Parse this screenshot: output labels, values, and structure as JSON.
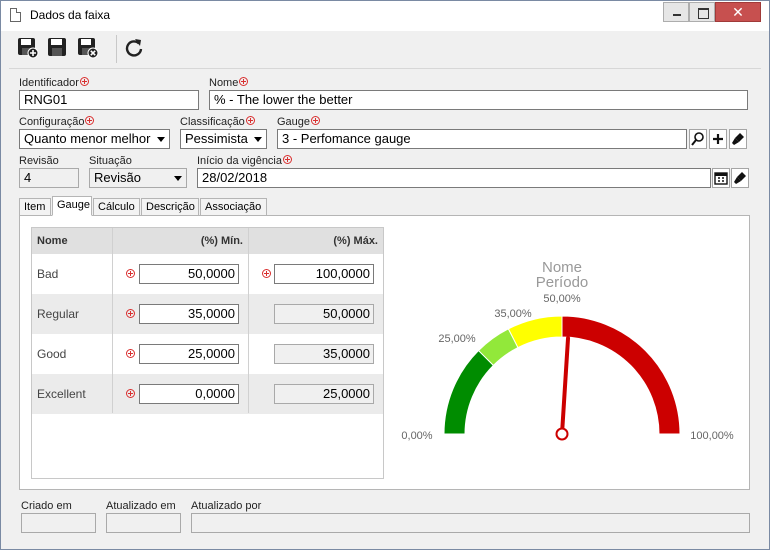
{
  "window": {
    "title": "Dados da faixa"
  },
  "toolbar": {
    "buttons": [
      "save-new-icon",
      "save-icon",
      "save-close-icon",
      "refresh-icon"
    ]
  },
  "form": {
    "identificador": {
      "label": "Identificador",
      "value": "RNG01"
    },
    "nome": {
      "label": "Nome",
      "value": "% - The lower the better"
    },
    "configuracao": {
      "label": "Configuração",
      "value": "Quanto menor melhor"
    },
    "classificacao": {
      "label": "Classificação",
      "value": "Pessimista"
    },
    "gauge": {
      "label": "Gauge",
      "value": "3 - Perfomance gauge"
    },
    "revisao": {
      "label": "Revisão",
      "value": "4"
    },
    "situacao": {
      "label": "Situação",
      "value": "Revisão"
    },
    "inicio": {
      "label": "Início da vigência",
      "value": "28/02/2018"
    }
  },
  "tabs": [
    {
      "label": "Item"
    },
    {
      "label": "Gauge",
      "active": true
    },
    {
      "label": "Cálculo"
    },
    {
      "label": "Descrição"
    },
    {
      "label": "Associação"
    }
  ],
  "grid": {
    "columns": [
      "Nome",
      "(%) Mín.",
      "(%) Máx."
    ],
    "rows": [
      {
        "name": "Bad",
        "min": "50,0000",
        "max": "100,0000",
        "max_editable": true
      },
      {
        "name": "Regular",
        "min": "35,0000",
        "max": "50,0000",
        "max_editable": false
      },
      {
        "name": "Good",
        "min": "25,0000",
        "max": "35,0000",
        "max_editable": false
      },
      {
        "name": "Excellent",
        "min": "0,0000",
        "max": "25,0000",
        "max_editable": false
      }
    ]
  },
  "gauge_chart": {
    "title": "Nome",
    "subtitle": "Período",
    "labels": {
      "min": "0,00%",
      "t25": "25,00%",
      "t35": "35,00%",
      "t50": "50,00%",
      "max": "100,00%"
    },
    "bands": [
      {
        "from": 0,
        "to": 25,
        "color": "#008c00"
      },
      {
        "from": 25,
        "to": 35,
        "color": "#92e83a"
      },
      {
        "from": 35,
        "to": 50,
        "color": "#ffff00"
      },
      {
        "from": 50,
        "to": 100,
        "color": "#cc0000"
      }
    ],
    "needle_value": 52,
    "needle_color": "#cc0000"
  },
  "footer": {
    "criado_em": "Criado em",
    "atualizado_em": "Atualizado em",
    "atualizado_por": "Atualizado por"
  }
}
